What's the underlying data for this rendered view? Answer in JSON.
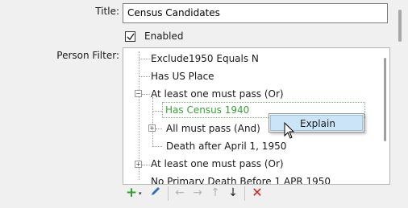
{
  "form": {
    "title_label": "Title:",
    "title_value": "Census Candidates",
    "enabled_label": "Enabled",
    "enabled_checked": true,
    "person_filter_label": "Person Filter:"
  },
  "tree": {
    "nodes": [
      "Exclude1950 Equals N",
      "Has US Place",
      "At least one must pass (Or)",
      "Has Census 1940",
      "All must pass (And)",
      "Death after April 1, 1950",
      "At least one must pass (Or)",
      "No Primary Death Before 1 APR 1950"
    ],
    "selected_node_color": "#3aa23a"
  },
  "context_menu": {
    "items": [
      "Explain"
    ]
  },
  "toolbar": {
    "icons": [
      "add-icon",
      "edit-icon",
      "move-left-icon",
      "move-right-icon",
      "move-up-icon",
      "move-down-icon",
      "delete-icon"
    ]
  }
}
